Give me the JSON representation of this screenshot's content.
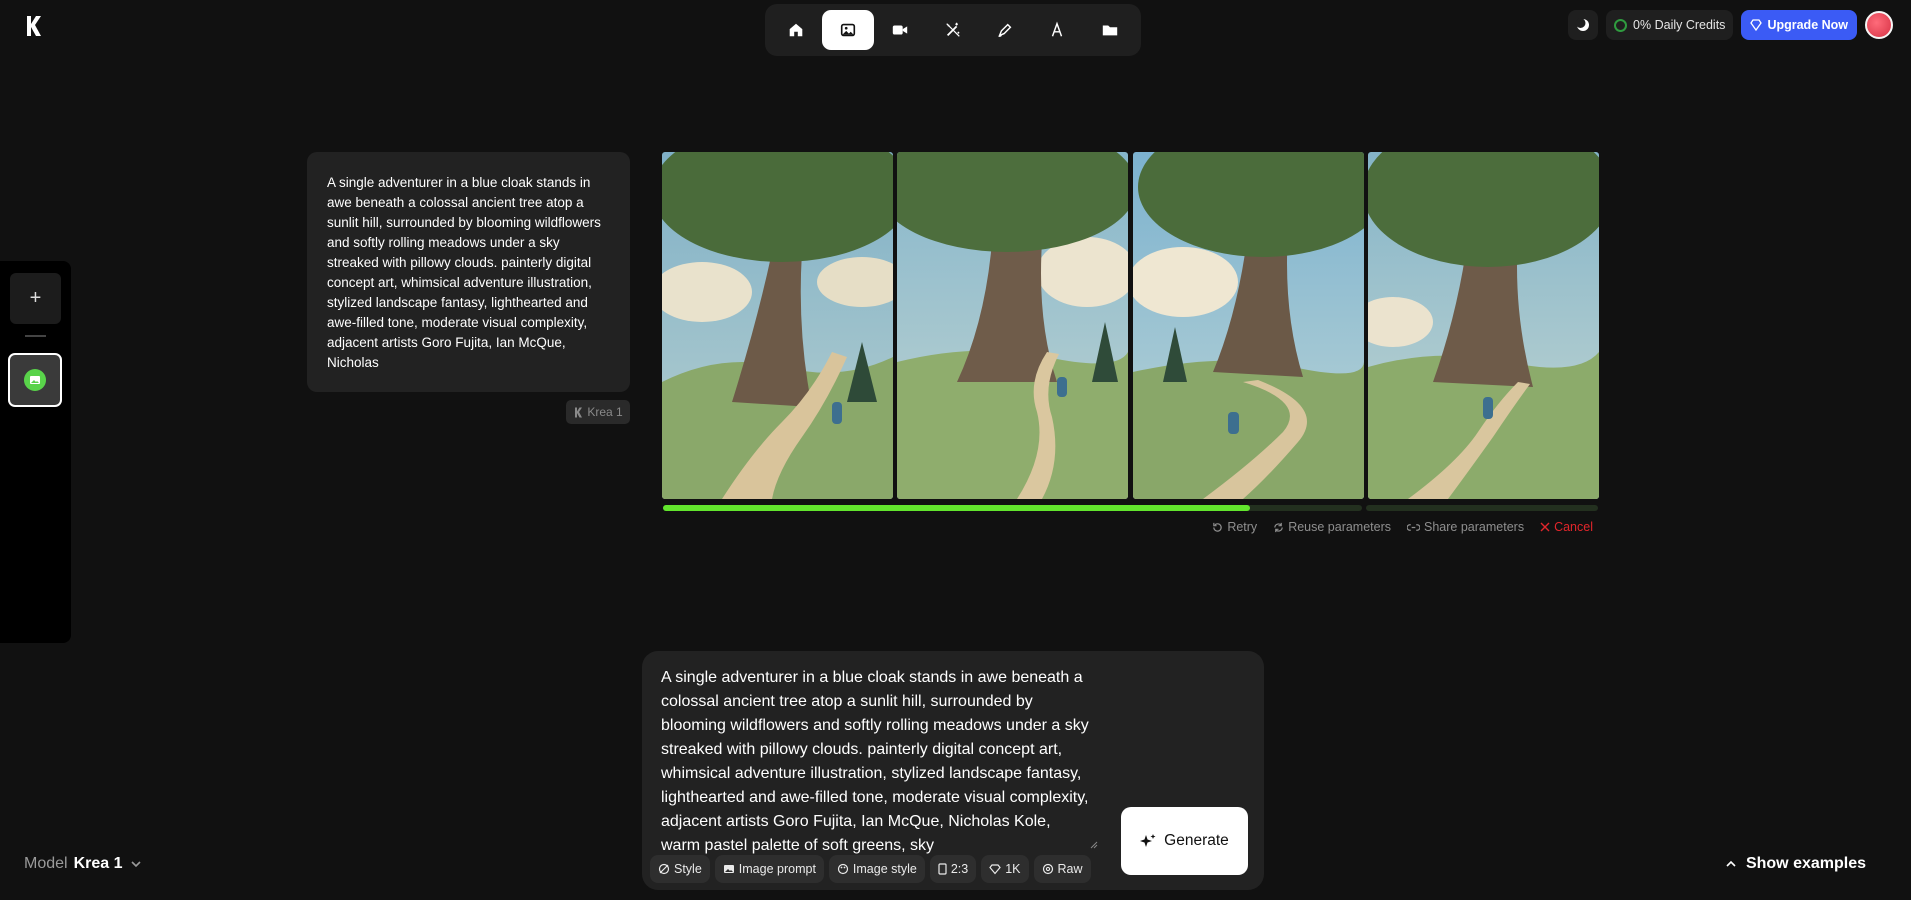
{
  "header": {
    "nav_icons": [
      "home-icon",
      "image-icon",
      "video-icon",
      "enhance-icon",
      "edit-icon",
      "font-icon",
      "folder-icon"
    ],
    "active_nav": "image-icon",
    "credits_label": "0% Daily Credits",
    "upgrade_label": "Upgrade Now"
  },
  "rail": {
    "add_label": "+"
  },
  "generation": {
    "prompt": "A single adventurer in a blue cloak stands in awe beneath a colossal ancient tree atop a sunlit hill, surrounded by blooming wildflowers and softly rolling meadows under a sky streaked with pillowy clouds. painterly digital concept art, whimsical adventure illustration, stylized landscape fantasy, lighthearted and awe-filled tone, moderate visual complexity, adjacent artists Goro Fujita, Ian McQue, Nicholas",
    "model_chip": "Krea 1",
    "progress": [
      1.0,
      1.0,
      0.52,
      0.0
    ],
    "actions": {
      "retry": "Retry",
      "reuse": "Reuse  parameters",
      "share": "Share  parameters",
      "cancel": "Cancel"
    }
  },
  "composer": {
    "prompt_text": "A single adventurer in a blue cloak stands in awe beneath a colossal ancient tree atop a sunlit hill, surrounded by blooming wildflowers and softly rolling meadows under a sky streaked with pillowy clouds. painterly digital concept art, whimsical adventure illustration, stylized landscape fantasy, lighthearted and awe-filled tone, moderate visual complexity, adjacent artists Goro Fujita, Ian McQue, Nicholas Kole, warm pastel palette of soft greens, sky",
    "generate_label": "Generate",
    "chips": {
      "style": "Style",
      "image_prompt": "Image prompt",
      "image_style": "Image style",
      "ratio": "2:3",
      "resolution": "1K",
      "raw": "Raw"
    }
  },
  "footer": {
    "model_label": "Model",
    "model_value": "Krea 1",
    "show_examples": "Show examples"
  }
}
